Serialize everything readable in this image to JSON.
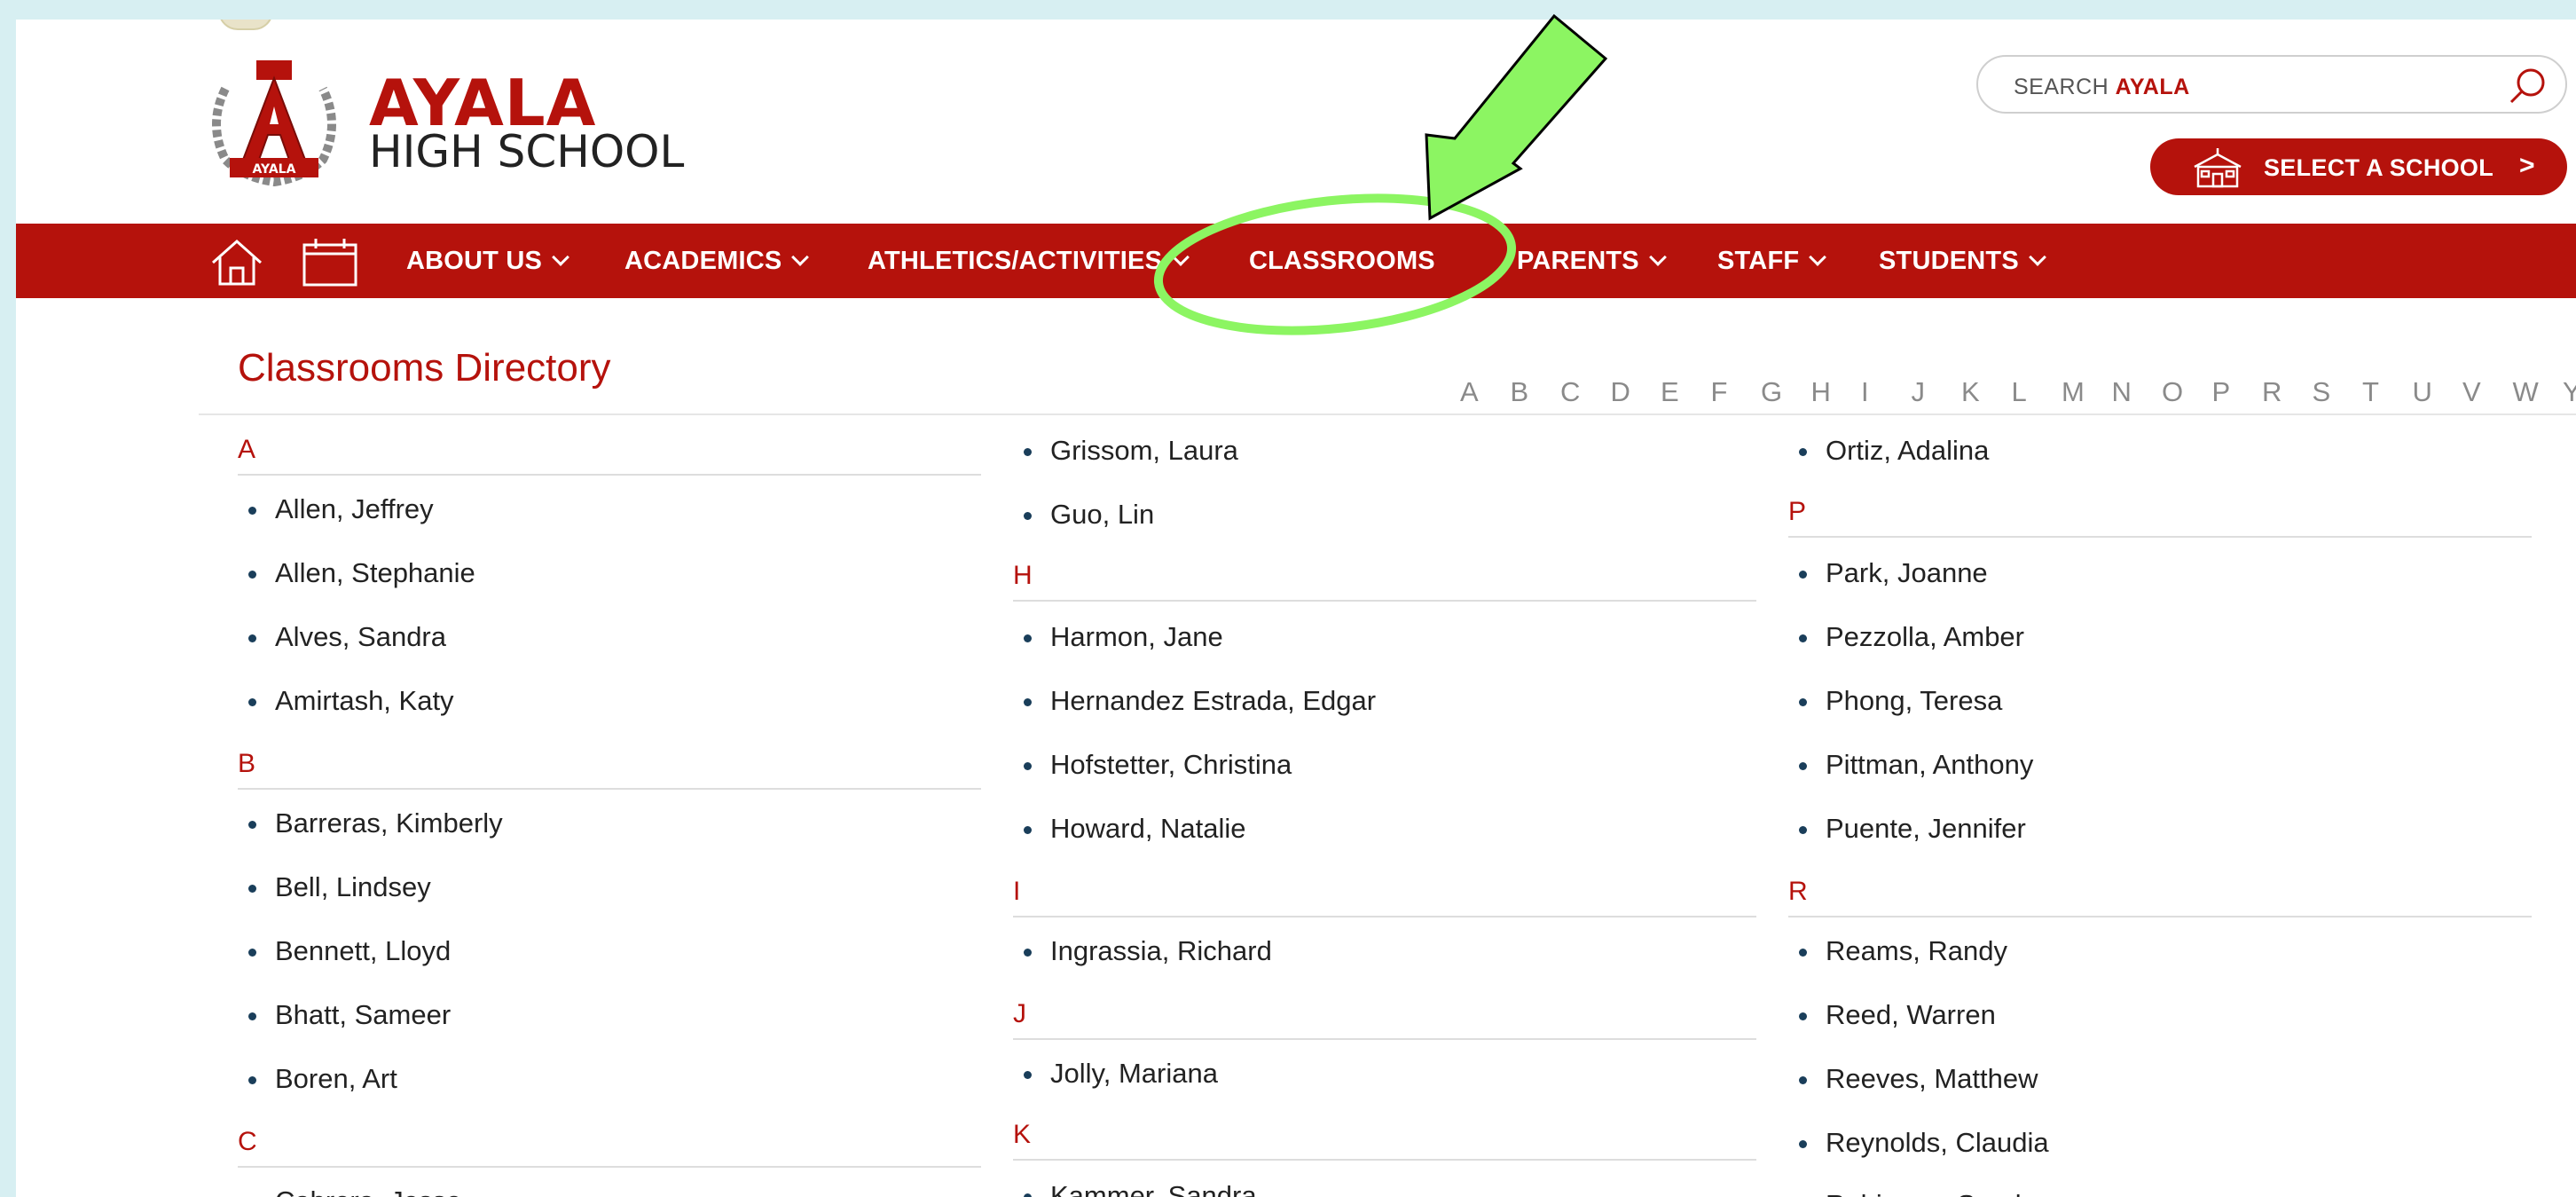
{
  "school": {
    "name": "AYALA",
    "subtitle": "HIGH SCHOOL",
    "logo_text": "AYALA"
  },
  "search": {
    "prefix": "SEARCH ",
    "school": "AYALA"
  },
  "select_school": {
    "label": "SELECT A SCHOOL",
    "chevron": ">"
  },
  "nav": {
    "about": "ABOUT US",
    "academics": "ACADEMICS",
    "athletics": "ATHLETICS/ACTIVITIES",
    "classrooms": "CLASSROOMS",
    "parents": "PARENTS",
    "staff": "STAFF",
    "students": "STUDENTS"
  },
  "directory": {
    "title": "Classrooms Directory",
    "alphabet": [
      "A",
      "B",
      "C",
      "D",
      "E",
      "F",
      "G",
      "H",
      "I",
      "J",
      "K",
      "L",
      "M",
      "N",
      "O",
      "P",
      "R",
      "S",
      "T",
      "U",
      "V",
      "W",
      "Y"
    ],
    "col1": {
      "letter_a": "A",
      "a": [
        "Allen, Jeffrey",
        "Allen, Stephanie",
        "Alves, Sandra",
        "Amirtash, Katy"
      ],
      "letter_b": "B",
      "b": [
        "Barreras, Kimberly",
        "Bell, Lindsey",
        "Bennett, Lloyd",
        "Bhatt, Sameer",
        "Boren, Art"
      ],
      "letter_c": "C",
      "c_partial": "Cabrera, Jesse"
    },
    "col2": {
      "g": [
        "Grissom, Laura",
        "Guo, Lin"
      ],
      "letter_h": "H",
      "h": [
        "Harmon, Jane",
        "Hernandez Estrada, Edgar",
        "Hofstetter, Christina",
        "Howard, Natalie"
      ],
      "letter_i": "I",
      "i": [
        "Ingrassia, Richard"
      ],
      "letter_j": "J",
      "j": [
        "Jolly, Mariana"
      ],
      "letter_k": "K",
      "k_partial": "Kammer, Sandra"
    },
    "col3": {
      "o": [
        "Ortiz, Adalina"
      ],
      "letter_p": "P",
      "p": [
        "Park, Joanne",
        "Pezzolla, Amber",
        "Phong, Teresa",
        "Pittman, Anthony",
        "Puente, Jennifer"
      ],
      "letter_r": "R",
      "r": [
        "Reams, Randy",
        "Reed, Warren",
        "Reeves, Matthew",
        "Reynolds, Claudia"
      ],
      "r_partial": "Robinson, Sandra"
    }
  },
  "colors": {
    "brand_red": "#b5120c",
    "highlight_green": "#8cf562",
    "background": "#d7eff2"
  }
}
